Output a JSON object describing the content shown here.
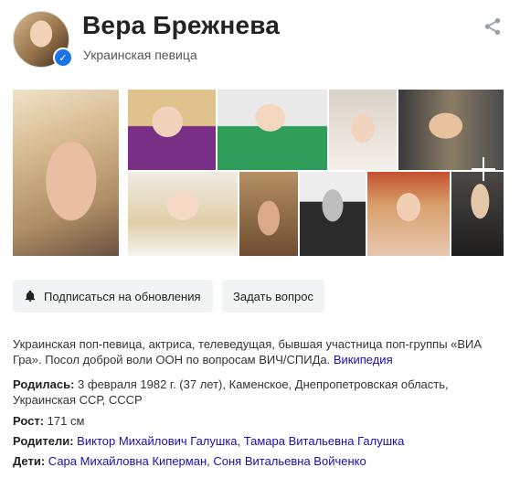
{
  "header": {
    "name": "Вера Брежнева",
    "subtitle": "Украинская певица"
  },
  "buttons": {
    "subscribe": "Подписаться на обновления",
    "ask": "Задать вопрос"
  },
  "description": {
    "text": "Украинская поп-певица, актриса, телеведущая, бывшая участница поп-группы «ВИА Гра». Посол доброй воли ООН по вопросам ВИЧ/СПИДа.",
    "source": "Википедия"
  },
  "facts": {
    "born": {
      "label": "Родилась:",
      "value": "3 февраля 1982 г. (37 лет), Каменское, Днепропетровская область, Украинская ССР, СССР"
    },
    "height": {
      "label": "Рост:",
      "value": "171 см"
    },
    "parents": {
      "label": "Родители:",
      "values": [
        "Виктор Михайлович Галушка",
        "Тамара Витальевна Галушка"
      ]
    },
    "children": {
      "label": "Дети:",
      "values": [
        "Сара Михайловна Киперман",
        "Соня Витальевна Войченко"
      ]
    }
  },
  "icons": {
    "share": "share-icon",
    "bell": "bell-icon",
    "verified": "verified-check-icon",
    "more_images": "plus-icon"
  },
  "colors": {
    "link": "#1a0dab",
    "wiki": "#1a7f37",
    "button_bg": "#f1f3f4",
    "verified": "#1a73e8"
  }
}
